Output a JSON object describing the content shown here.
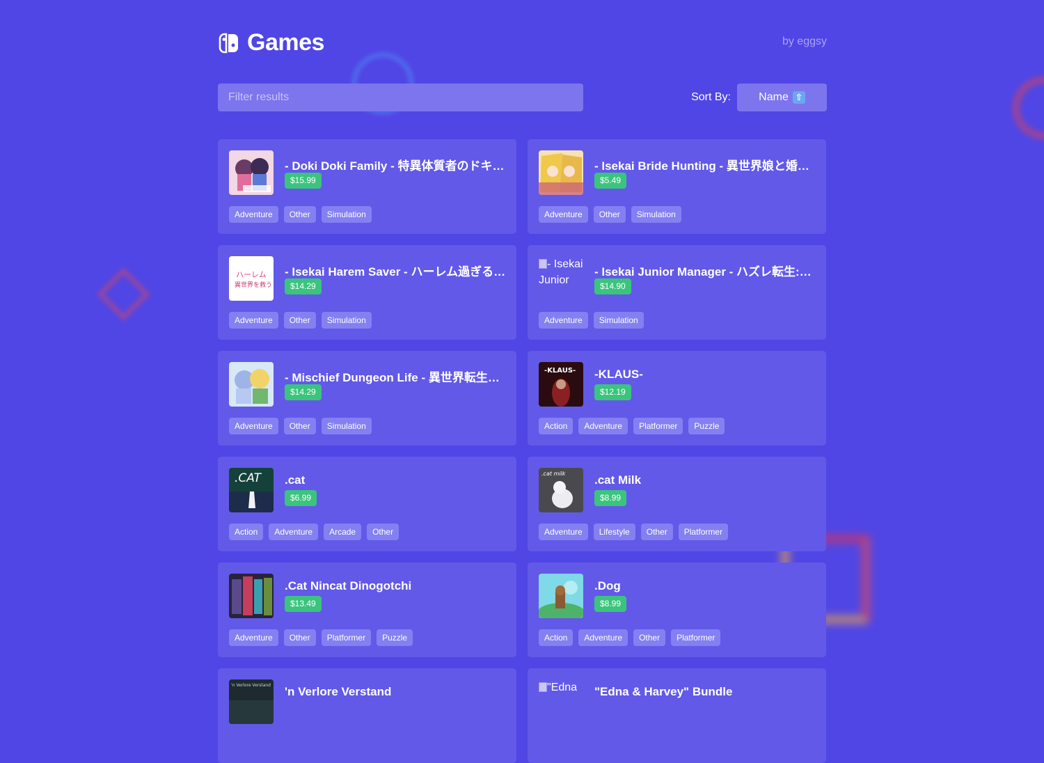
{
  "header": {
    "title": "Games",
    "byline": "by eggsy"
  },
  "filter": {
    "placeholder": "Filter results"
  },
  "sort": {
    "label": "Sort By:",
    "value": "Name",
    "direction_icon": "arrow-up-icon"
  },
  "colors": {
    "background": "#5046e5",
    "card": "#6259e8",
    "price_badge": "#3bc47d",
    "tag": "#8480f1"
  },
  "games": [
    {
      "title": "- Doki Doki Family - 特異体質者のドキド...",
      "price": "$15.99",
      "tags": [
        "Adventure",
        "Other",
        "Simulation"
      ],
      "thumb_alt": ""
    },
    {
      "title": "- Isekai Bride Hunting - 異世界娘と婚活...",
      "price": "$5.49",
      "tags": [
        "Adventure",
        "Other",
        "Simulation"
      ],
      "thumb_alt": ""
    },
    {
      "title": "- Isekai Harem Saver - ハーレム過ぎる異...",
      "price": "$14.29",
      "tags": [
        "Adventure",
        "Other",
        "Simulation"
      ],
      "thumb_alt": ""
    },
    {
      "title": "- Isekai Junior Manager - ハズレ転生:最...",
      "price": "$14.90",
      "tags": [
        "Adventure",
        "Simulation"
      ],
      "thumb_alt": "- Isekai Junior"
    },
    {
      "title": "- Mischief Dungeon Life - 異世界転生し...",
      "price": "$14.29",
      "tags": [
        "Adventure",
        "Other",
        "Simulation"
      ],
      "thumb_alt": ""
    },
    {
      "title": "-KLAUS-",
      "price": "$12.19",
      "tags": [
        "Action",
        "Adventure",
        "Platformer",
        "Puzzle"
      ],
      "thumb_alt": ""
    },
    {
      "title": ".cat",
      "price": "$6.99",
      "tags": [
        "Action",
        "Adventure",
        "Arcade",
        "Other"
      ],
      "thumb_alt": ""
    },
    {
      "title": ".cat Milk",
      "price": "$8.99",
      "tags": [
        "Adventure",
        "Lifestyle",
        "Other",
        "Platformer"
      ],
      "thumb_alt": ""
    },
    {
      "title": ".Cat Nincat Dinogotchi",
      "price": "$13.49",
      "tags": [
        "Adventure",
        "Other",
        "Platformer",
        "Puzzle"
      ],
      "thumb_alt": ""
    },
    {
      "title": ".Dog",
      "price": "$8.99",
      "tags": [
        "Action",
        "Adventure",
        "Other",
        "Platformer"
      ],
      "thumb_alt": ""
    },
    {
      "title": "'n Verlore Verstand",
      "price": "",
      "tags": [],
      "thumb_alt": ""
    },
    {
      "title": "\"Edna & Harvey\" Bundle",
      "price": "",
      "tags": [],
      "thumb_alt": "\"Edna"
    }
  ]
}
